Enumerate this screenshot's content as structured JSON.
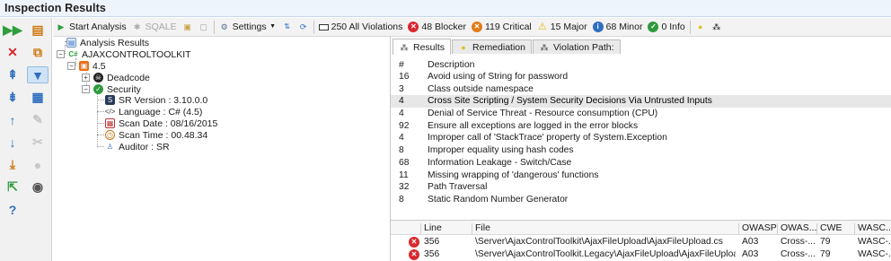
{
  "window": {
    "title": "Inspection Results"
  },
  "colors": {
    "critical": "#d8282d",
    "blocker": "#d8282d",
    "major": "#e8c21a",
    "minor": "#2f6fc1",
    "info": "#2f9a3c",
    "accent": "#97bbdf"
  },
  "toolbar": {
    "start_analysis": "Start Analysis",
    "sqale": "SQALE",
    "settings": "Settings",
    "all_violations": "250 All Violations",
    "blocker": "48 Blocker",
    "critical": "119 Critical",
    "major": "15 Major",
    "minor": "68 Minor",
    "info": "0 Info"
  },
  "tree": {
    "root": "Analysis Results",
    "project": "AJAXCONTROLTOOLKIT",
    "version": "4.5",
    "deadcode": "Deadcode",
    "security": "Security",
    "details": [
      {
        "label": "SR Version : 3.10.0.0",
        "icon": "sr-version-icon"
      },
      {
        "label": "Language  : C# (4.5)",
        "icon": "language-icon"
      },
      {
        "label": "Scan Date  : 08/16/2015",
        "icon": "calendar-icon"
      },
      {
        "label": "Scan Time  : 00.48.34",
        "icon": "clock-icon"
      },
      {
        "label": "Auditor  : SR",
        "icon": "auditor-icon"
      }
    ]
  },
  "tabs": [
    {
      "label": "Results",
      "icon": "results-icon"
    },
    {
      "label": "Remediation",
      "icon": "remediation-icon"
    },
    {
      "label": "Violation Path:",
      "icon": "violation-path-icon"
    }
  ],
  "results": {
    "col_num": "#",
    "col_desc": "Description",
    "rows": [
      {
        "count": "16",
        "desc": "Avoid using of String for password"
      },
      {
        "count": "3",
        "desc": "Class outside namespace"
      },
      {
        "count": "4",
        "desc": "Cross Site Scripting / System Security Decisions Via Untrusted Inputs",
        "selected": true
      },
      {
        "count": "4",
        "desc": "Denial of Service Threat - Resource consumption (CPU)"
      },
      {
        "count": "92",
        "desc": "Ensure all exceptions are logged in the error blocks"
      },
      {
        "count": "4",
        "desc": "Improper call of 'StackTrace' property of System.Exception"
      },
      {
        "count": "8",
        "desc": "Improper equality using hash codes"
      },
      {
        "count": "68",
        "desc": "Information Leakage - Switch/Case"
      },
      {
        "count": "11",
        "desc": "Missing wrapping of 'dangerous' functions"
      },
      {
        "count": "32",
        "desc": "Path Traversal"
      },
      {
        "count": "8",
        "desc": "Static Random Number Generator"
      }
    ]
  },
  "detail": {
    "headers": {
      "line": "Line",
      "file": "File",
      "owasp": "OWASP",
      "owas2": "OWAS...",
      "cwe": "CWE",
      "wasc": "WASC..."
    },
    "rows": [
      {
        "line": "356",
        "file": "\\Server\\AjaxControlToolkit\\AjaxFileUpload\\AjaxFileUpload.cs",
        "owasp": "A03",
        "owas2": "Cross-...",
        "cwe": "79",
        "wasc": "WASC-..."
      },
      {
        "line": "356",
        "file": "\\Server\\AjaxControlToolkit.Legacy\\AjaxFileUpload\\AjaxFileUpload.cs",
        "owasp": "A03",
        "owas2": "Cross-...",
        "cwe": "79",
        "wasc": "WASC-..."
      }
    ]
  }
}
